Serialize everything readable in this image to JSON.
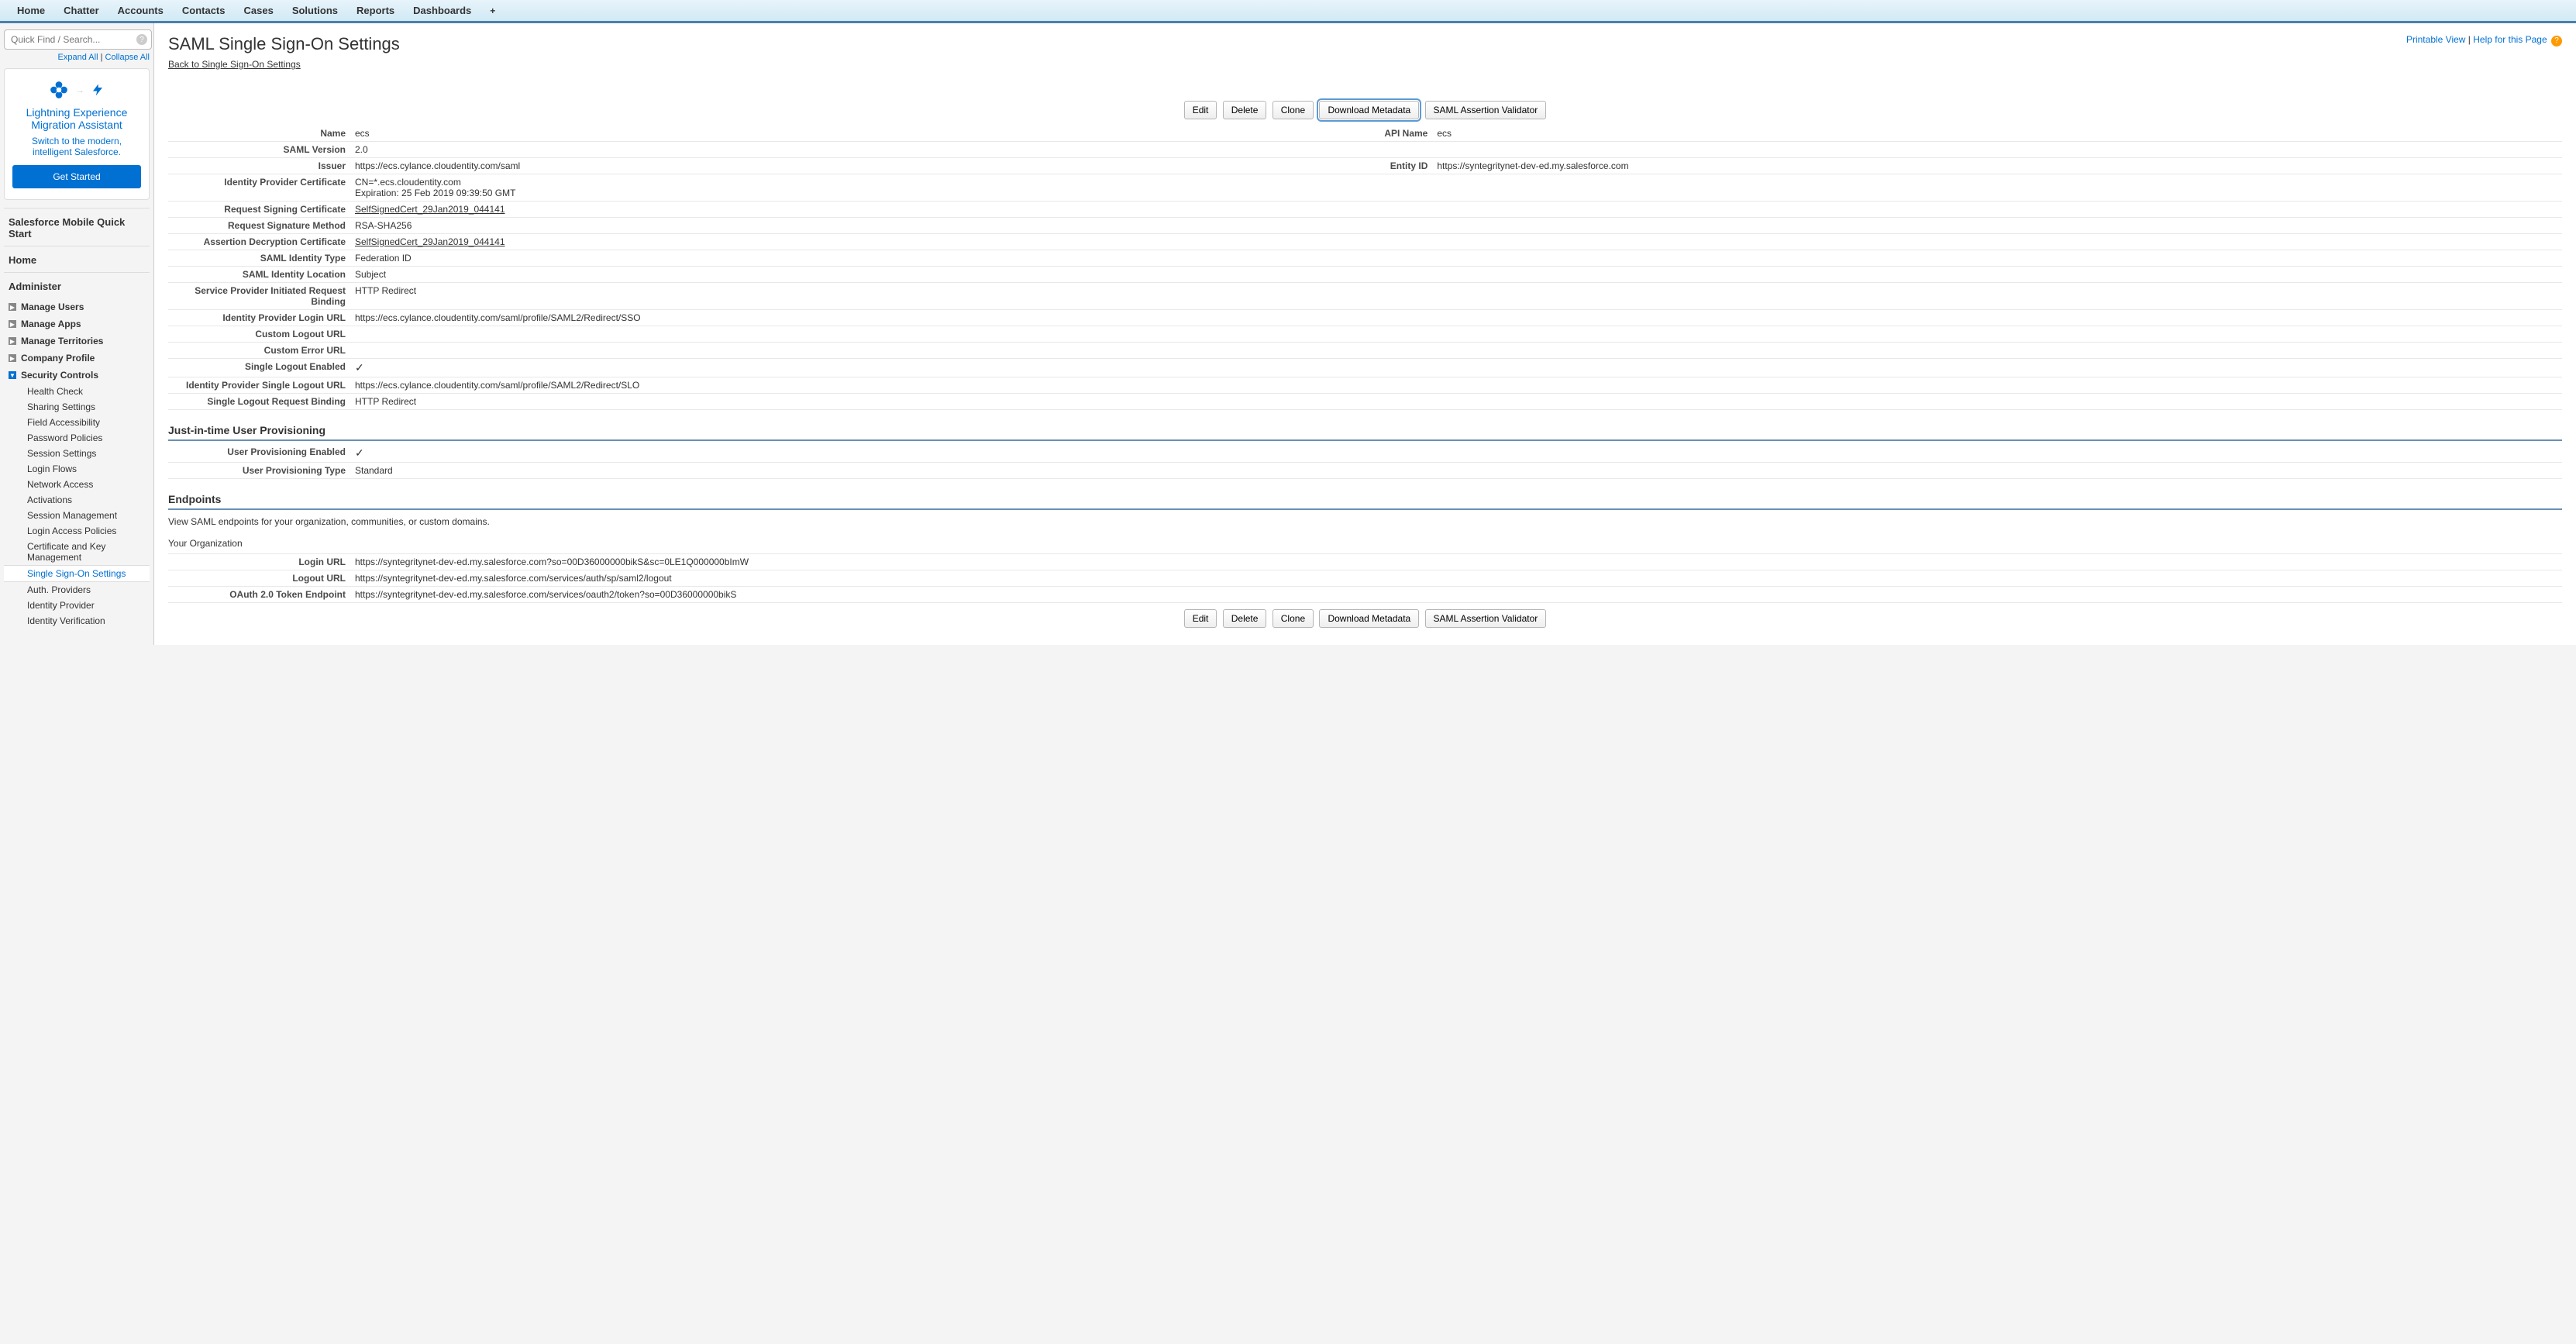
{
  "topnav": {
    "tabs": [
      "Home",
      "Chatter",
      "Accounts",
      "Contacts",
      "Cases",
      "Solutions",
      "Reports",
      "Dashboards"
    ]
  },
  "sidebar": {
    "search_placeholder": "Quick Find / Search...",
    "expand_all": "Expand All",
    "collapse_all": "Collapse All",
    "promo": {
      "title": "Lightning Experience Migration Assistant",
      "subtitle": "Switch to the modern, intelligent Salesforce.",
      "button": "Get Started"
    },
    "quick_start": "Salesforce Mobile Quick Start",
    "home": "Home",
    "administer": "Administer",
    "admin_items": [
      {
        "label": "Manage Users",
        "expanded": false
      },
      {
        "label": "Manage Apps",
        "expanded": false
      },
      {
        "label": "Manage Territories",
        "expanded": false
      },
      {
        "label": "Company Profile",
        "expanded": false
      },
      {
        "label": "Security Controls",
        "expanded": true
      }
    ],
    "security_subs": [
      "Health Check",
      "Sharing Settings",
      "Field Accessibility",
      "Password Policies",
      "Session Settings",
      "Login Flows",
      "Network Access",
      "Activations",
      "Session Management",
      "Login Access Policies",
      "Certificate and Key Management",
      "Single Sign-On Settings",
      "Auth. Providers",
      "Identity Provider",
      "Identity Verification"
    ],
    "active_sub": "Single Sign-On Settings"
  },
  "page": {
    "title": "SAML Single Sign-On Settings",
    "printable_view": "Printable View",
    "help_link": "Help for this Page",
    "back_link": "Back to Single Sign-On Settings"
  },
  "buttons": {
    "edit": "Edit",
    "delete": "Delete",
    "clone": "Clone",
    "download_metadata": "Download Metadata",
    "saml_validator": "SAML Assertion Validator"
  },
  "details": {
    "name_label": "Name",
    "name_value": "ecs",
    "api_name_label": "API Name",
    "api_name_value": "ecs",
    "saml_version_label": "SAML Version",
    "saml_version_value": "2.0",
    "issuer_label": "Issuer",
    "issuer_value": "https://ecs.cylance.cloudentity.com/saml",
    "entity_id_label": "Entity ID",
    "entity_id_value": "https://syntegritynet-dev-ed.my.salesforce.com",
    "idp_cert_label": "Identity Provider Certificate",
    "idp_cert_cn": "CN=*.ecs.cloudentity.com",
    "idp_cert_exp": "Expiration: 25 Feb 2019 09:39:50 GMT",
    "req_sign_cert_label": "Request Signing Certificate",
    "req_sign_cert_value": "SelfSignedCert_29Jan2019_044141",
    "req_sig_method_label": "Request Signature Method",
    "req_sig_method_value": "RSA-SHA256",
    "assert_decrypt_label": "Assertion Decryption Certificate",
    "assert_decrypt_value": "SelfSignedCert_29Jan2019_044141",
    "saml_id_type_label": "SAML Identity Type",
    "saml_id_type_value": "Federation ID",
    "saml_id_loc_label": "SAML Identity Location",
    "saml_id_loc_value": "Subject",
    "sp_binding_label": "Service Provider Initiated Request Binding",
    "sp_binding_value": "HTTP Redirect",
    "idp_login_label": "Identity Provider Login URL",
    "idp_login_value": "https://ecs.cylance.cloudentity.com/saml/profile/SAML2/Redirect/SSO",
    "custom_logout_label": "Custom Logout URL",
    "custom_logout_value": "",
    "custom_error_label": "Custom Error URL",
    "custom_error_value": "",
    "slo_enabled_label": "Single Logout Enabled",
    "idp_slo_url_label": "Identity Provider Single Logout URL",
    "idp_slo_url_value": "https://ecs.cylance.cloudentity.com/saml/profile/SAML2/Redirect/SLO",
    "slo_binding_label": "Single Logout Request Binding",
    "slo_binding_value": "HTTP Redirect"
  },
  "jit": {
    "header": "Just-in-time User Provisioning",
    "enabled_label": "User Provisioning Enabled",
    "type_label": "User Provisioning Type",
    "type_value": "Standard"
  },
  "endpoints": {
    "header": "Endpoints",
    "desc": "View SAML endpoints for your organization, communities, or custom domains.",
    "your_org": "Your Organization",
    "login_label": "Login URL",
    "login_value": "https://syntegritynet-dev-ed.my.salesforce.com?so=00D36000000bikS&sc=0LE1Q000000bImW",
    "logout_label": "Logout URL",
    "logout_value": "https://syntegritynet-dev-ed.my.salesforce.com/services/auth/sp/saml2/logout",
    "oauth_label": "OAuth 2.0 Token Endpoint",
    "oauth_value": "https://syntegritynet-dev-ed.my.salesforce.com/services/oauth2/token?so=00D36000000bikS"
  }
}
